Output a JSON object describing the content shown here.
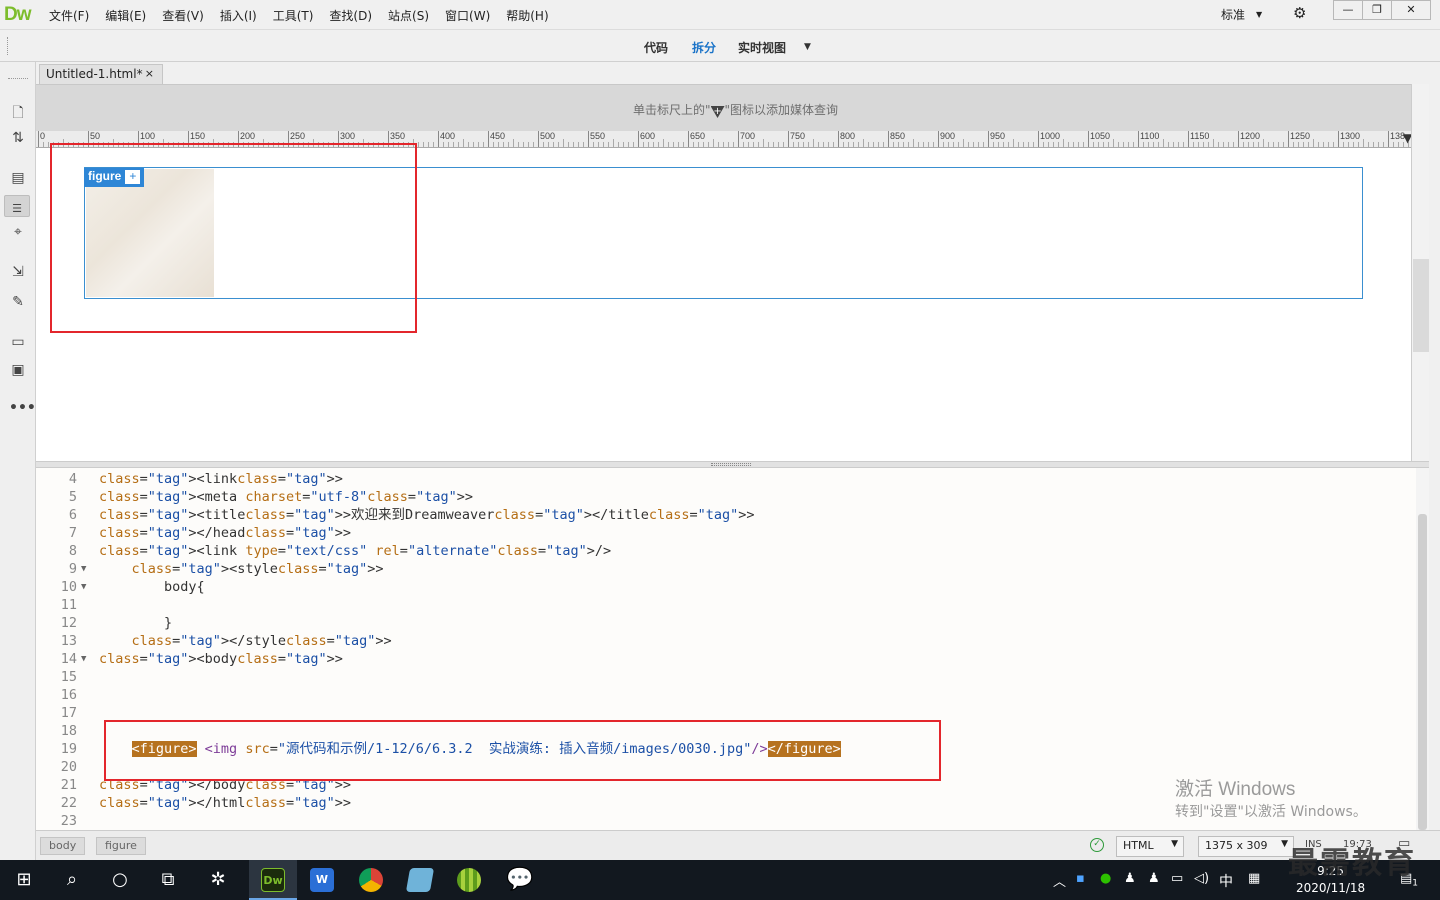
{
  "app": {
    "logo": "Dw",
    "menu": [
      "文件(F)",
      "编辑(E)",
      "查看(V)",
      "插入(I)",
      "工具(T)",
      "查找(D)",
      "站点(S)",
      "窗口(W)",
      "帮助(H)"
    ],
    "workspace": "标准",
    "window_buttons": {
      "minimize": "—",
      "restore": "❐",
      "close": "✕"
    }
  },
  "view_bar": {
    "code": "代码",
    "split": "拆分",
    "live": "实时视图",
    "active": "拆分"
  },
  "document": {
    "tab_title": "Untitled-1.html*",
    "tab_close": "×"
  },
  "media_query_bar": {
    "hint_prefix": "单击标尺上的\"",
    "hint_suffix": "\"图标以添加媒体查询"
  },
  "ruler": {
    "labels": [
      "0",
      "50",
      "100",
      "150",
      "200",
      "250",
      "300",
      "350",
      "400",
      "450",
      "500",
      "550",
      "600",
      "650",
      "700",
      "750",
      "800",
      "850",
      "900",
      "950",
      "1000",
      "1050",
      "1100",
      "1150",
      "1200",
      "1250",
      "1300",
      "138"
    ]
  },
  "design_view": {
    "figure_badge": "figure",
    "figure_add": "+"
  },
  "code_view": {
    "lines": [
      {
        "n": "4",
        "fold": "",
        "text": "<link>"
      },
      {
        "n": "5",
        "fold": "",
        "text": "<meta charset=\"utf-8\">"
      },
      {
        "n": "6",
        "fold": "",
        "text": "<title>欢迎来到Dreamweaver</title>"
      },
      {
        "n": "7",
        "fold": "",
        "text": "</head>"
      },
      {
        "n": "8",
        "fold": "",
        "text": "<link type=\"text/css\" rel=\"alternate\"/>"
      },
      {
        "n": "9",
        "fold": "▼",
        "text": "    <style>"
      },
      {
        "n": "10",
        "fold": "▼",
        "text": "        body{"
      },
      {
        "n": "11",
        "fold": "",
        "text": ""
      },
      {
        "n": "12",
        "fold": "",
        "text": "        }"
      },
      {
        "n": "13",
        "fold": "",
        "text": "    </style>"
      },
      {
        "n": "14",
        "fold": "▼",
        "text": "<body>"
      },
      {
        "n": "15",
        "fold": "",
        "text": ""
      },
      {
        "n": "16",
        "fold": "",
        "text": ""
      },
      {
        "n": "17",
        "fold": "",
        "text": ""
      },
      {
        "n": "18",
        "fold": "",
        "text": ""
      },
      {
        "n": "19",
        "fold": "",
        "text": ""
      },
      {
        "n": "20",
        "fold": "",
        "text": ""
      },
      {
        "n": "21",
        "fold": "",
        "text": "</body>"
      },
      {
        "n": "22",
        "fold": "",
        "text": "</html>"
      },
      {
        "n": "23",
        "fold": "",
        "text": ""
      }
    ],
    "line19": {
      "open_tag": "<figure>",
      "img_prefix": " <img ",
      "img_attr": "src",
      "img_eq": "=",
      "img_value": "\"源代码和示例/1-12/6/6.3.2  实战演练: 插入音频/images/0030.jpg\"",
      "img_close": "/>",
      "close_tag": "</figure>"
    }
  },
  "watermark": {
    "line1": "激活 Windows",
    "line2": "转到\"设置\"以激活 Windows。"
  },
  "status_bar": {
    "crumbs": [
      "body",
      "figure"
    ],
    "doc_type": "HTML",
    "window_size": "1375 x 309",
    "mode": "INS",
    "position": "19:73"
  },
  "taskbar": {
    "ime": "中",
    "time": "9:25",
    "date": "2020/11/18",
    "notification_count": "1"
  },
  "brand_watermark": "最需教育"
}
